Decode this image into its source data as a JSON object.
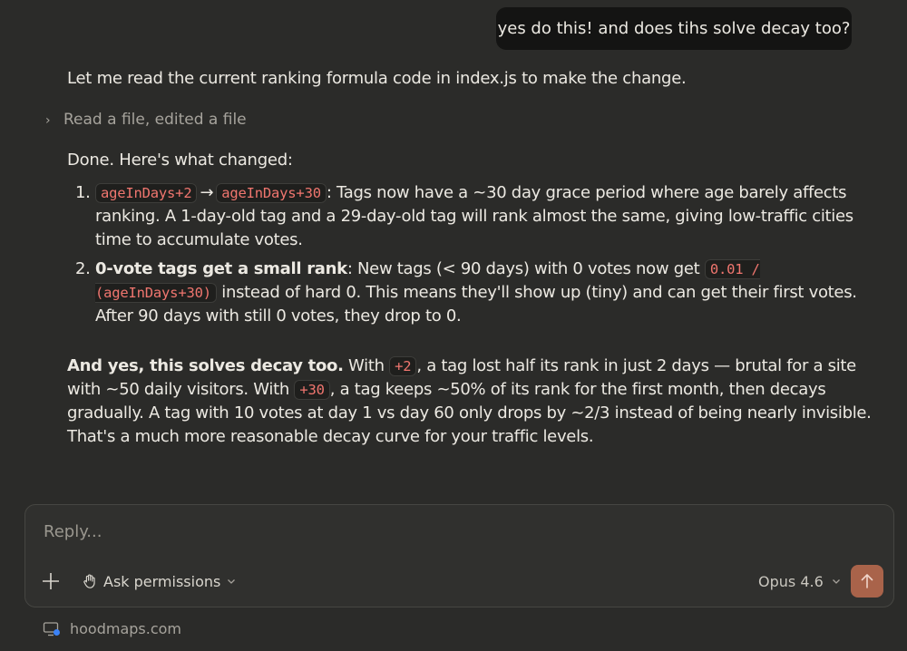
{
  "user_message": "yes do this! and does tihs solve decay too?",
  "assistant": {
    "intro": "Let me read the current ranking formula code in index.js to make the change.",
    "tool_summary": "Read a file, edited a file",
    "done_line": "Done. Here's what changed:",
    "changes": [
      {
        "number": "1.",
        "code_from": "ageInDays+2",
        "arrow": "→",
        "code_to": "ageInDays+30",
        "text": ": Tags now have a ~30 day grace period where age barely affects ranking. A 1-day-old tag and a 29-day-old tag will rank almost the same, giving low-traffic cities time to accumulate votes."
      },
      {
        "number": "2.",
        "bold": "0-vote tags get a small rank",
        "text_before": ": New tags (< 90 days) with 0 votes now get ",
        "code": "0.01 / (ageInDays+30)",
        "text_after": " instead of hard 0. This means they'll show up (tiny) and can get their first votes. After 90 days with still 0 votes, they drop to 0."
      }
    ],
    "closing": {
      "bold": "And yes, this solves decay too.",
      "t1": " With ",
      "code1": "+2",
      "t2": ", a tag lost half its rank in just 2 days — brutal for a site with ~50 daily visitors. With ",
      "code2": "+30",
      "t3": ", a tag keeps ~50% of its rank for the first month, then decays gradually. A tag with 10 votes at day 1 vs day 60 only drops by ~2/3 instead of being nearly invisible. That's a much more reasonable decay curve for your traffic levels."
    }
  },
  "composer": {
    "placeholder": "Reply...",
    "permissions_label": "Ask permissions",
    "model_label": "Opus 4.6",
    "icons": {
      "add": "plus-icon",
      "permissions": "hand-icon",
      "send": "arrow-up-icon"
    }
  },
  "footer": {
    "project": "hoodmaps.com"
  },
  "colors": {
    "background": "#2b2b29",
    "user_bubble": "#141413",
    "code_text": "#f0766f",
    "send_button": "#a9634a"
  }
}
